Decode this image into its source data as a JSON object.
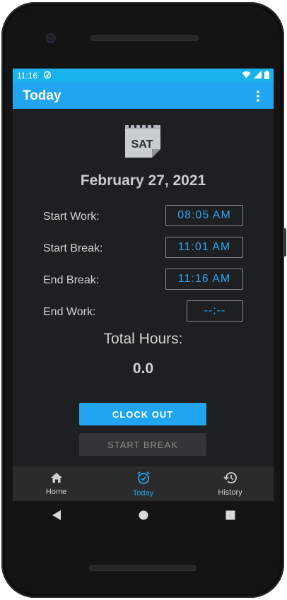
{
  "status_bar": {
    "time": "11:16"
  },
  "app_bar": {
    "title": "Today"
  },
  "calendar_icon": {
    "day_abbr": "SAT"
  },
  "date_text": "February 27, 2021",
  "rows": [
    {
      "label": "Start Work:",
      "value": "08:05 AM"
    },
    {
      "label": "Start Break:",
      "value": "11:01 AM"
    },
    {
      "label": "End Break:",
      "value": "11:16 AM"
    },
    {
      "label": "End Work:",
      "value": "--:--"
    }
  ],
  "total": {
    "label": "Total Hours:",
    "value": "0.0"
  },
  "buttons": {
    "primary": "CLOCK OUT",
    "secondary": "START BREAK"
  },
  "bottom_nav": [
    {
      "label": "Home",
      "icon": "home-icon",
      "active": false
    },
    {
      "label": "Today",
      "icon": "alarm-check-icon",
      "active": true
    },
    {
      "label": "History",
      "icon": "history-icon",
      "active": false
    }
  ],
  "colors": {
    "accent": "#21a5f0",
    "status_bar": "#19b2ec",
    "background": "#1e1f20"
  }
}
